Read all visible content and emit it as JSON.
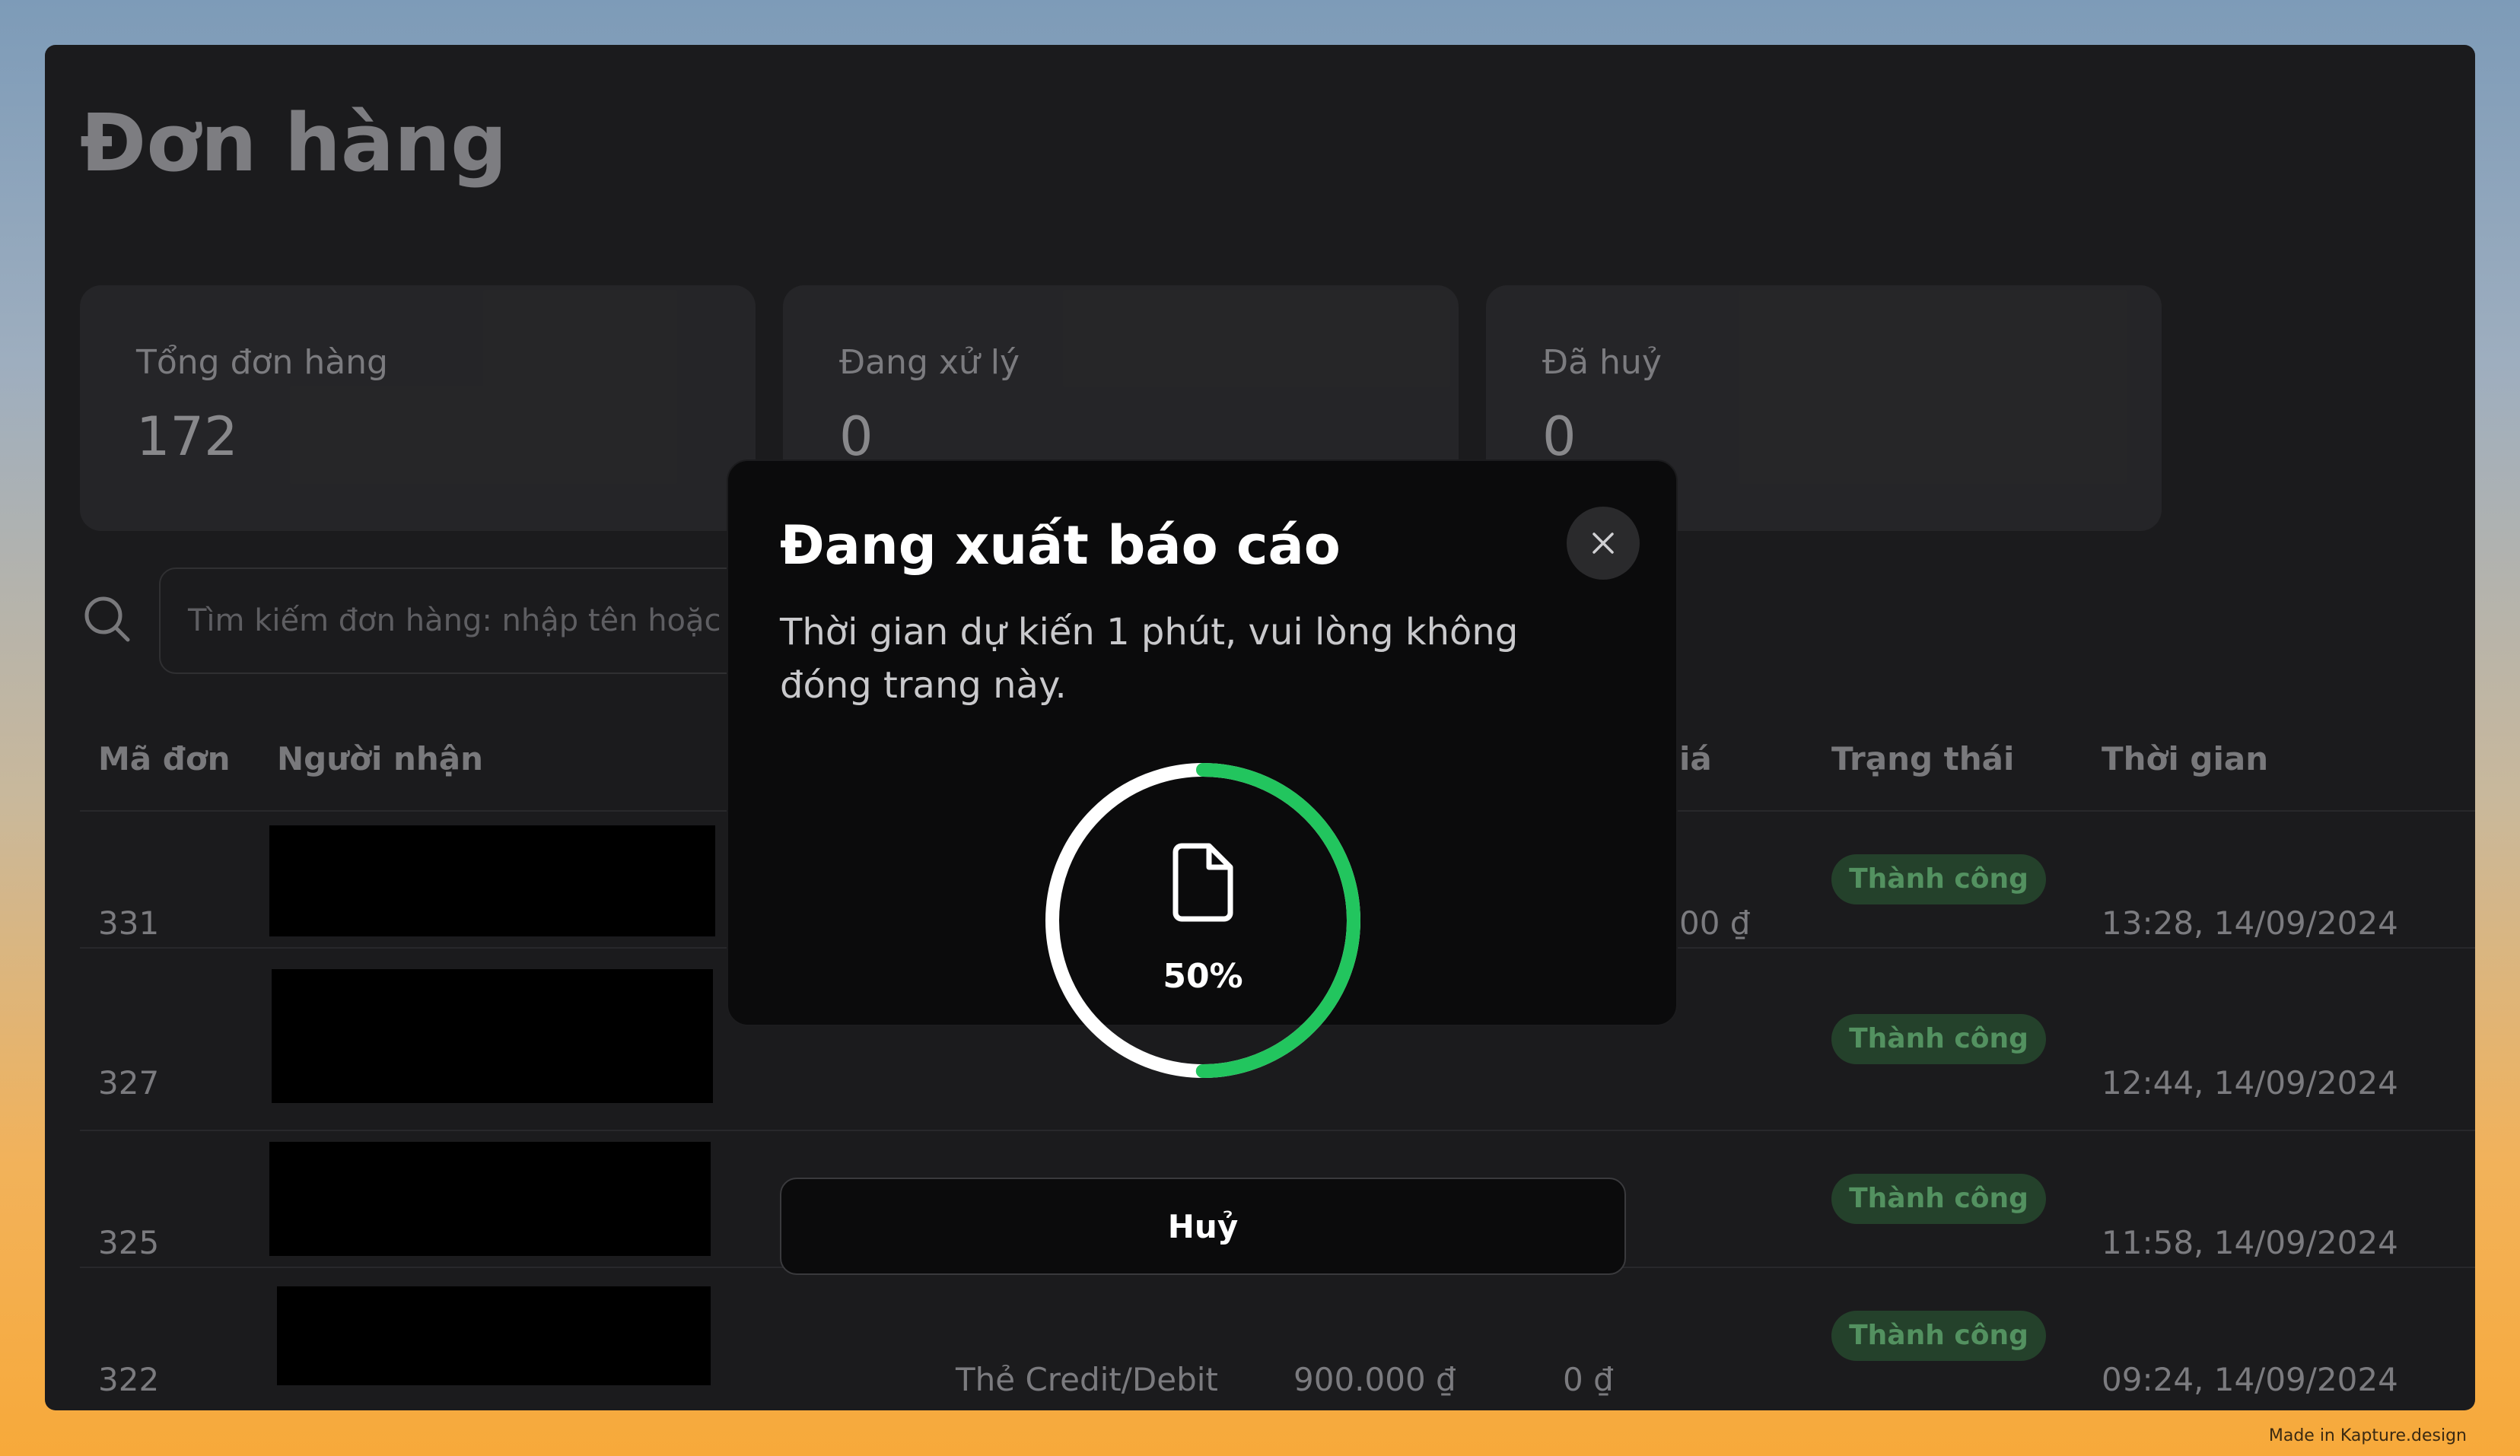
{
  "page": {
    "title": "Đơn hàng"
  },
  "stats": [
    {
      "label": "Tổng đơn hàng",
      "value": "172"
    },
    {
      "label": "Đang xử lý",
      "value": "0"
    },
    {
      "label": "Đã huỷ",
      "value": "0"
    }
  ],
  "search": {
    "placeholder": "Tìm kiếm đơn hàng: nhập tên hoặc"
  },
  "table": {
    "headers": {
      "order_id": "Mã đơn",
      "recipient": "Người nhận",
      "price_partial": "iá",
      "status": "Trạng thái",
      "time": "Thời gian"
    },
    "rows": [
      {
        "id": "331",
        "price_partial": "00 ₫",
        "status": "Thành công",
        "time": "13:28, 14/09/2024"
      },
      {
        "id": "327",
        "status": "Thành công",
        "time": "12:44, 14/09/2024"
      },
      {
        "id": "325",
        "status": "Thành công",
        "time": "11:58, 14/09/2024"
      },
      {
        "id": "322",
        "payment": "Thẻ Credit/Debit",
        "amount": "900.000 ₫",
        "discount": "0 ₫",
        "status": "Thành công",
        "time": "09:24, 14/09/2024"
      }
    ]
  },
  "modal": {
    "title": "Đang xuất báo cáo",
    "description": "Thời gian dự kiến 1 phút, vui lòng không đóng trang này.",
    "progress_value": 50,
    "progress_label": "50%",
    "cancel_label": "Huỷ",
    "progress_color": "#22c55e"
  },
  "footer": {
    "credit": "Made in Kapture.design"
  }
}
